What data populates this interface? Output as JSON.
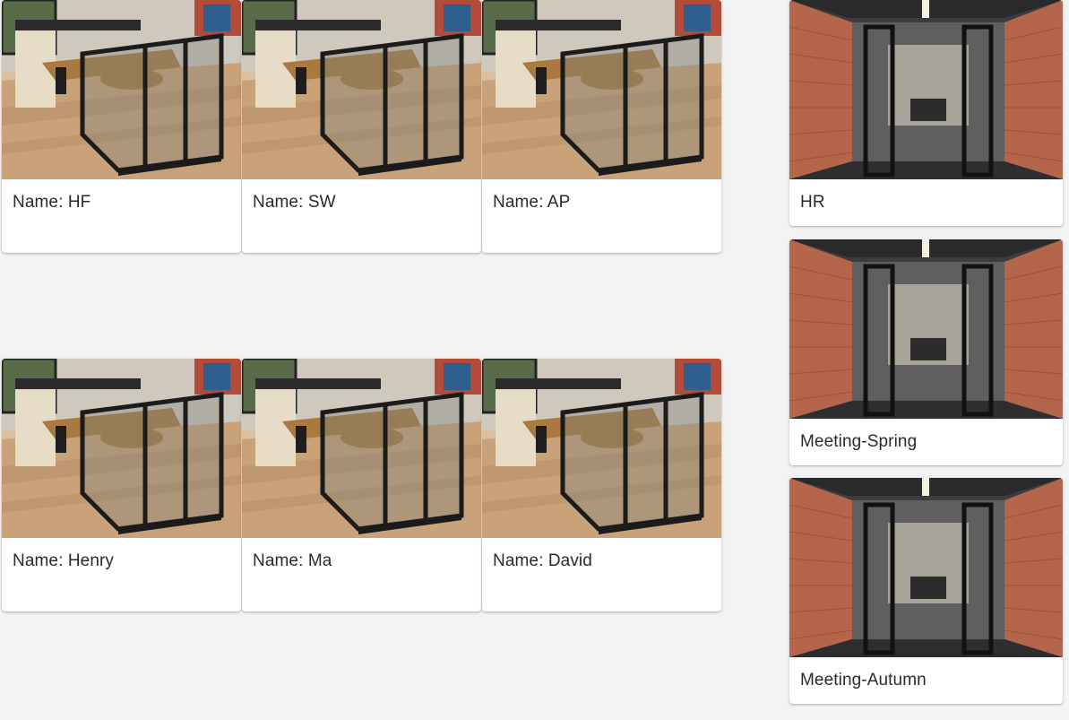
{
  "desks": [
    {
      "label": "Name: HF"
    },
    {
      "label": "Name: SW"
    },
    {
      "label": "Name: AP"
    },
    {
      "label": "Name: Henry"
    },
    {
      "label": "Name: Ma"
    },
    {
      "label": "Name: David"
    }
  ],
  "rooms": [
    {
      "label": "HR"
    },
    {
      "label": "Meeting-Spring"
    },
    {
      "label": "Meeting-Autumn"
    }
  ]
}
